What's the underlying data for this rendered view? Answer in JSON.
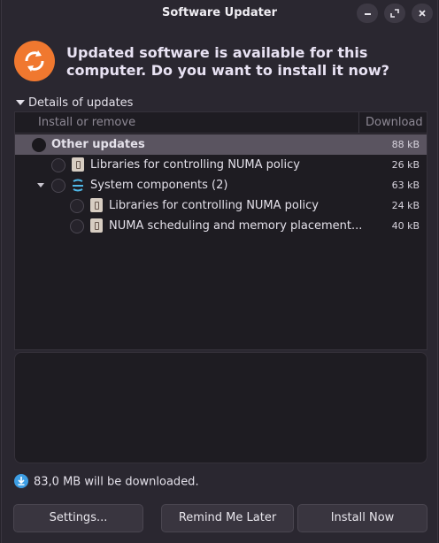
{
  "window": {
    "title": "Software Updater",
    "controls": [
      "minimize-icon",
      "maximize-icon",
      "close-icon"
    ]
  },
  "header": {
    "icon": "software-updater-icon",
    "headline": "Updated software is available for this computer. Do you want to install it now?"
  },
  "details": {
    "expander_label": "Details of updates",
    "expanded": true,
    "columns": {
      "install": "Install or remove",
      "download": "Download"
    },
    "rows": [
      {
        "label": "Other updates",
        "size": "88 kB",
        "level": 0,
        "selected": true,
        "icon": ""
      },
      {
        "label": "Libraries for controlling NUMA policy",
        "size": "26 kB",
        "level": 1,
        "icon": "package-icon"
      },
      {
        "label": "System components (2)",
        "size": "63 kB",
        "level": 1,
        "icon": "system-components-icon",
        "expanded": true
      },
      {
        "label": "Libraries for controlling NUMA policy",
        "size": "24 kB",
        "level": 2,
        "icon": "package-icon"
      },
      {
        "label": "NUMA scheduling and memory placement...",
        "size": "40 kB",
        "level": 2,
        "icon": "package-icon"
      }
    ]
  },
  "download_info": {
    "icon": "download-icon",
    "text": "83,0 MB will be downloaded."
  },
  "buttons": {
    "settings": "Settings...",
    "remind": "Remind Me Later",
    "install": "Install Now"
  },
  "colors": {
    "accent_orange": "#f0782f",
    "selection": "#5a5460",
    "download_blue": "#3d9ee4"
  }
}
